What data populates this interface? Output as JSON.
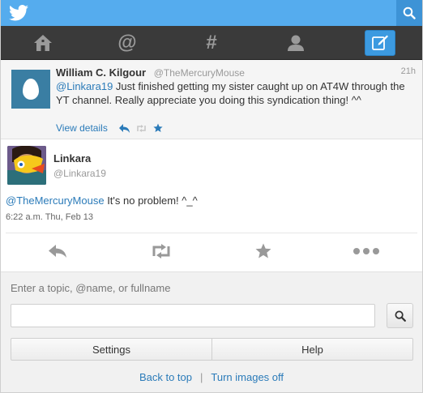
{
  "header": {
    "logo_icon": "twitter-bird-icon",
    "search_icon": "search-icon",
    "brand_color": "#55acee"
  },
  "nav": {
    "items": [
      {
        "icon": "home-icon"
      },
      {
        "icon": "at-mention-icon"
      },
      {
        "icon": "hashtag-discover-icon"
      },
      {
        "icon": "profile-icon"
      },
      {
        "icon": "compose-tweet-icon",
        "active": true
      }
    ]
  },
  "parent_tweet": {
    "fullname": "William C. Kilgour",
    "handle": "@TheMercuryMouse",
    "time": "21h",
    "mention": "@Linkara19",
    "text": " Just finished getting my sister caught up on AT4W through the YT channel. Really appreciate you doing this syndication thing! ^^",
    "view_details": "View details",
    "action_icons": [
      "reply-icon",
      "retweet-icon",
      "favorite-icon"
    ]
  },
  "detail_tweet": {
    "fullname": "Linkara",
    "handle": "@Linkara19",
    "mention": "@TheMercuryMouse",
    "text": " It's no problem! ^_^",
    "timestamp": "6:22 a.m. Thu, Feb 13",
    "action_icons": [
      "reply-icon",
      "retweet-icon",
      "favorite-icon",
      "more-icon"
    ]
  },
  "search": {
    "hint": "Enter a topic, @name, or fullname",
    "value": "",
    "button_icon": "search-icon"
  },
  "buttons": {
    "settings": "Settings",
    "help": "Help"
  },
  "footer": {
    "back_to_top": "Back to top",
    "separator": "|",
    "turn_images_off": "Turn images off"
  }
}
